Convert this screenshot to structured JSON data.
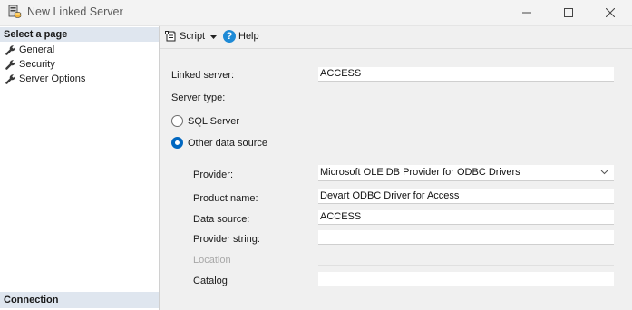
{
  "window": {
    "title": "New Linked Server",
    "icon": "database-server-icon"
  },
  "left_pane": {
    "select_page_header": "Select a page",
    "pages": [
      {
        "label": "General",
        "icon": "wrench-icon"
      },
      {
        "label": "Security",
        "icon": "wrench-icon"
      },
      {
        "label": "Server Options",
        "icon": "wrench-icon"
      }
    ],
    "connection_header": "Connection"
  },
  "toolbar": {
    "script_label": "Script",
    "help_label": "Help"
  },
  "form": {
    "linked_server_label": "Linked server:",
    "linked_server_value": "ACCESS",
    "server_type_label": "Server type:",
    "sql_server_label": "SQL Server",
    "other_data_source_label": "Other data source",
    "selected_server_type": "Other data source",
    "provider_label": "Provider:",
    "provider_value": "Microsoft OLE DB Provider for ODBC Drivers",
    "product_name_label": "Product name:",
    "product_name_value": "Devart ODBC Driver for Access",
    "data_source_label": "Data source:",
    "data_source_value": "ACCESS",
    "provider_string_label": "Provider string:",
    "provider_string_value": "",
    "location_label": "Location",
    "location_value": "",
    "catalog_label": "Catalog",
    "catalog_value": ""
  },
  "colors": {
    "accent": "#0067c0",
    "header_bg": "#dfe6ef"
  }
}
